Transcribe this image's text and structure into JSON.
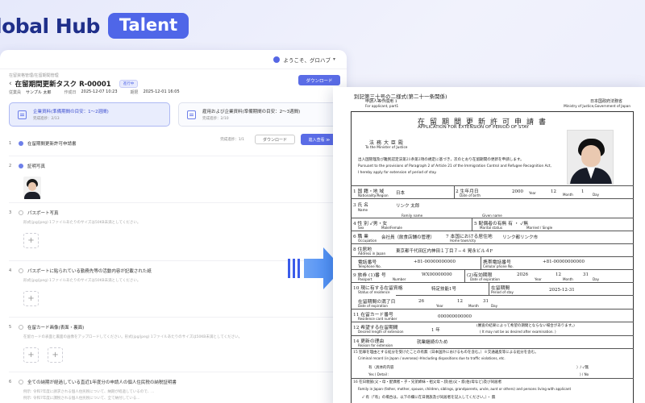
{
  "brand": {
    "name": "lobal Hub",
    "tag": "Talent"
  },
  "app": {
    "user_greeting": "ようこそ、グロハブ",
    "breadcrumb": "在留資格管理/在留期間管理",
    "title": "在留期間更新タスク R-00001",
    "status_badge": "進行中",
    "download_label": "ダウンロード",
    "meta": [
      {
        "label": "従業員",
        "value": "サンプル 太郎"
      },
      {
        "label": "作成日",
        "value": "2025-12-07 10:23"
      },
      {
        "label": "期限",
        "value": "2025-12-01 16:05"
      }
    ],
    "phases": [
      {
        "title": "企業資料(準備期間の目安：1～2週間)",
        "sub": "完成進捗：2/13"
      },
      {
        "title": "雇用および企業資料(準備期間の目安：2～3週間)",
        "sub": "完成進捗：2/10"
      }
    ],
    "items": [
      {
        "num": "1",
        "label": "在留期間更新許可申請書",
        "done": true,
        "progress_label": "完成進捗：",
        "progress": "1/1",
        "dl_label": "ダウンロード",
        "go_label": "進入查看 ≫"
      },
      {
        "num": "2",
        "label": "証明写真",
        "done": true
      },
      {
        "num": "3",
        "label": "パスポート写真",
        "done": false,
        "note": "形式(jpg/jpeg) 1ファイルあたりのサイズは50KB未満としてください。"
      },
      {
        "num": "4",
        "label": "パスポートに貼られている勤務先等の活動内容が記載された紙",
        "done": false,
        "note": "形式(jpg/jpeg) 1ファイルあたりのサイズは50KB未満としてください。"
      },
      {
        "num": "5",
        "label": "在留カード画像(表面・裏面)",
        "done": false,
        "note": "在留カードの表面と裏面の画像をアップロードしてください。形式(jpg/jpeg) 1ファイルあたりのサイズは50KB未満としてください。"
      },
      {
        "num": "6",
        "label": "全ての納期が経過している直近1年度分の申請人の個人住民税の納税証明書",
        "done": false,
        "note": "",
        "note1": "例示: 令和7年度に請求される個人住民税について、納期が経過しているので、...",
        "note2": "例示: 令和7年度に課税される個人住民税について、全て納付している..."
      }
    ]
  },
  "doc": {
    "form_no": "別記第三十号の二様式(第二十一条関係)",
    "form_sub": "申請人等作成用 1",
    "form_sub_en": "For applicant, part1",
    "ministry_jp": "日本国政府法務省",
    "ministry_en": "Ministry of Justice,Government of Japan",
    "title_jp": "在留期間更新許可申請書",
    "title_en": "APPLICATION FOR EXTENSION OF PERIOD OF STAY",
    "to_min_jp": "法務大臣殿",
    "to_min_en": "To the Minister of Justice",
    "pursuant_jp": "出入国管理及び難民認定法第21条第2項の規定に基づき，次のとおり在留期間の更新を申請します。",
    "pursuant_en1": "Pursuant to the provisions of Paragraph 2 of Article 21 of the Immigration Control and Refugee Recognition Act,",
    "pursuant_en2": "I hereby apply for extension of period of stay.",
    "rows": {
      "nationality_jp": "1 国 籍・地 域",
      "nationality_en": "Nationality/Region",
      "nationality_val": "日本",
      "dob_jp": "2 生年月日",
      "dob_en": "Date of birth",
      "dob_year": "2000",
      "dob_month": "12",
      "dob_day": "1",
      "year_en": "Year",
      "month_en": "Month",
      "day_en": "Day",
      "name_jp": "3 氏 名",
      "name_en": "Name",
      "family_en": "Family name",
      "given_en": "Given name",
      "name_val": "リンク 太郎",
      "sex_jp": "4 性 別 ✓男・女",
      "sex_en": "Sex",
      "sex_opt": "Male/Female",
      "marital_jp": "5 配偶者の有無 有 ・ ✓無",
      "marital_en": "Marital status",
      "marital_opt": "Married / Single",
      "occupation_jp": "6 職 業",
      "occupation_en": "Occupation",
      "occupation_val": "会社員（飲食店舗の管理）",
      "home_jp": "7 本国における居住地",
      "home_en": "Home town/city",
      "home_val": "リンク都リンク市",
      "address_jp": "8 住居地",
      "address_en": "Address in Japan",
      "address_val": "東京都千代田区内神田１丁目７−４ 晃永ビル４F",
      "tel_jp": "電話番号",
      "tel_en": "Telephone No.",
      "tel_val": "+81-00000000000",
      "cell_jp": "携帯電話番号",
      "cell_en": "Cellular phone No.",
      "cell_val": "+81-00000000000",
      "passport_jp": "9 旅券 (1)番 号",
      "passport_en": "Passport",
      "passport_num_en": "Number",
      "passport_val": "WX00000000",
      "expiry_jp": "(2)有効期限",
      "expiry_en": "Date of expiration",
      "expiry_year": "2026",
      "expiry_month": "12",
      "expiry_day": "31",
      "status_jp": "10 現に有する在留資格",
      "status_en": "Status of residence",
      "status_val": "特定技能1号",
      "period_jp": "在留期間",
      "period_en": "Period of stay",
      "period_val": "2025-12-31",
      "exp_jp": "在留期間の満了日",
      "exp_en": "Date of expiration",
      "exp_year": "26",
      "exp_month": "12",
      "exp_day": "31",
      "card_jp": "11 在留カード番号",
      "card_en": "Residence card number",
      "card_val": "000000000000",
      "ext_jp": "12 希望する在留期間",
      "ext_en": "Desired length of extension",
      "ext_val": "1 年",
      "ext_note": "(審査の結果によって希望の期間とならない場合があります。)",
      "ext_note_en": "( It may not be as desired after examination. )",
      "reason_jp": "14 更新の理由",
      "reason_en": "Reason for extension",
      "reason_val": "就業継続のため",
      "crime_jp": "15 犯罪を理由とする処分を受けたことの有無（日本国外におけるものを含む。）※交通違反等による処分を含む。",
      "crime_en": "Criminal record (in Japan / overseas) ※Including dispositions due to traffic violations, etc.",
      "crime_yes_jp": "有（具体的内容",
      "crime_yes_en": "Yes ( Detail :",
      "crime_no": "）/ ✓無",
      "crime_no_en": ") / No",
      "family_jp": "16 在日親族(父・母・配偶者・子・兄弟姉妹・祖父母・叔(伯)父・叔(伯)母など)及び同居者",
      "family_en2": "Family in Japan (father, mother, spouse, children, siblings, grandparents, uncle, aunt or others) and persons living with applicant",
      "family_q": "✓ 有（「有」の場合は，以下の欄に在日親族及び同居者を記入してください。）・ 無"
    }
  }
}
